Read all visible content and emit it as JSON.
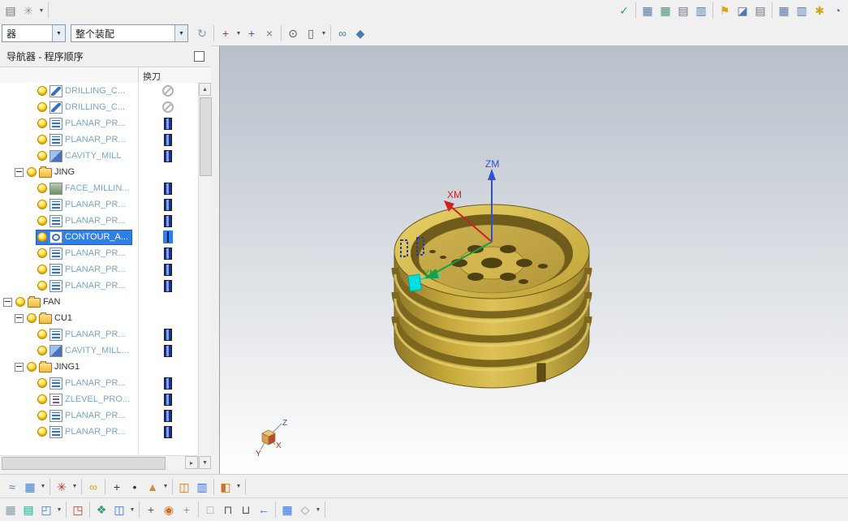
{
  "titlebar": {
    "left_icons": [
      {
        "name": "display-part-icon",
        "glyph": "▤",
        "color": "#4a7ab5"
      },
      {
        "name": "wcs-star-icon",
        "glyph": "✳",
        "color": "#8a97a5",
        "dropdown": true
      },
      {
        "sep": true
      }
    ],
    "right_icons": [
      {
        "name": "verify-check-icon",
        "glyph": "✓",
        "color": "#1faa3c"
      },
      {
        "sep": true
      },
      {
        "name": "worksheet-icon-1",
        "glyph": "▦",
        "color": "#4a7ab5"
      },
      {
        "name": "worksheet-icon-2",
        "glyph": "▦",
        "color": "#2e9e7a"
      },
      {
        "name": "worksheet-icon-3",
        "glyph": "▤",
        "color": "#4a7ab5"
      },
      {
        "name": "worksheet-icon-4",
        "glyph": "▥",
        "color": "#4a7ab5"
      },
      {
        "sep": true
      },
      {
        "name": "pin-icon",
        "glyph": "⚑",
        "color": "#e0a020"
      },
      {
        "name": "report-icon-1",
        "glyph": "◪",
        "color": "#4a7ab5"
      },
      {
        "name": "report-icon-2",
        "glyph": "▤",
        "color": "#4a7ab5"
      },
      {
        "sep": true
      },
      {
        "name": "report-icon-3",
        "glyph": "▦",
        "color": "#4a7ab5"
      },
      {
        "name": "report-icon-4",
        "glyph": "▥",
        "color": "#4a7ab5"
      },
      {
        "name": "tools-icon",
        "glyph": "✱",
        "color": "#d8a020"
      },
      {
        "name": "clock-icon",
        "glyph": "◔",
        "color": "#4a7ab5"
      }
    ]
  },
  "toolbar2": {
    "selection_filter_value": "器",
    "assembly_scope_value": "整个装配",
    "icons": [
      {
        "name": "refresh-icon",
        "glyph": "↻",
        "color": "#8a97a5"
      },
      {
        "sep": true
      },
      {
        "name": "snap-point-icon",
        "glyph": "+",
        "color": "#c03030",
        "dropdown": true
      },
      {
        "name": "snap-rotate-icon",
        "glyph": "+",
        "color": "#2b5fd9"
      },
      {
        "name": "snap-quick-icon",
        "glyph": "×",
        "color": "#7a7a7a"
      },
      {
        "sep": true
      },
      {
        "name": "circle-center-icon",
        "glyph": "⊙",
        "color": "#555555"
      },
      {
        "name": "rect-select-icon",
        "glyph": "▯",
        "color": "#555555",
        "dropdown": true
      },
      {
        "sep": true
      },
      {
        "name": "glasses-icon",
        "glyph": "∞",
        "color": "#4a7ab5"
      },
      {
        "name": "shaded-cube-icon",
        "glyph": "◆",
        "color": "#4a7ab5"
      }
    ]
  },
  "navigator": {
    "title": "导航器 - 程序顺序",
    "tool_change_column": "换刀",
    "rows": [
      {
        "label": "DRILLING_C...",
        "icon": "drill",
        "indent": 2,
        "tool": "none"
      },
      {
        "label": "DRILLING_C...",
        "icon": "drill",
        "indent": 2,
        "tool": "none"
      },
      {
        "label": "PLANAR_PR...",
        "icon": "planar",
        "indent": 2,
        "tool": "bar"
      },
      {
        "label": "PLANAR_PR...",
        "icon": "planar",
        "indent": 2,
        "tool": "bar"
      },
      {
        "label": "CAVITY_MILL",
        "icon": "cavity",
        "indent": 2,
        "tool": "bar"
      },
      {
        "label": "JING",
        "icon": "folder",
        "indent": 1,
        "toggle": true
      },
      {
        "label": "FACE_MILLIN...",
        "icon": "face",
        "indent": 2,
        "tool": "bar"
      },
      {
        "label": "PLANAR_PR...",
        "icon": "planar",
        "indent": 2,
        "tool": "bar"
      },
      {
        "label": "PLANAR_PR...",
        "icon": "planar",
        "indent": 2,
        "tool": "bar"
      },
      {
        "label": "CONTOUR_A...",
        "icon": "contour",
        "indent": 2,
        "tool": "bar",
        "selected": true
      },
      {
        "label": "PLANAR_PR...",
        "icon": "planar",
        "indent": 2,
        "tool": "bar"
      },
      {
        "label": "PLANAR_PR...",
        "icon": "planar",
        "indent": 2,
        "tool": "bar"
      },
      {
        "label": "PLANAR_PR...",
        "icon": "planar",
        "indent": 2,
        "tool": "bar"
      },
      {
        "label": "FAN",
        "icon": "folder",
        "indent": 0,
        "toggle": true
      },
      {
        "label": "CU1",
        "icon": "folder",
        "indent": 1,
        "toggle": true
      },
      {
        "label": "PLANAR_PR...",
        "icon": "planar",
        "indent": 2,
        "tool": "bar"
      },
      {
        "label": "CAVITY_MILL...",
        "icon": "cavity",
        "indent": 2,
        "tool": "bar"
      },
      {
        "label": "JING1",
        "icon": "folder",
        "indent": 1,
        "toggle": true
      },
      {
        "label": "PLANAR_PR...",
        "icon": "planar",
        "indent": 2,
        "tool": "bar"
      },
      {
        "label": "ZLEVEL_PRO...",
        "icon": "zlevel",
        "indent": 2,
        "tool": "bar"
      },
      {
        "label": "PLANAR_PR...",
        "icon": "planar",
        "indent": 2,
        "tool": "bar"
      },
      {
        "label": "PLANAR_PR...",
        "icon": "planar",
        "indent": 2,
        "tool": "bar"
      }
    ]
  },
  "viewport": {
    "axis_zm": "ZM",
    "axis_xm": "XM",
    "axis_ym": "YM",
    "triad_z": "Z",
    "triad_x": "X",
    "triad_y": "Y",
    "part_color": "#d0b347"
  },
  "toolbar_bottom1": {
    "icons": [
      {
        "name": "surface-wave-icon",
        "glyph": "≈",
        "color": "#4a7ab5"
      },
      {
        "name": "grid-ruler-icon",
        "glyph": "▦",
        "color": "#4a7ab5",
        "dropdown": true
      },
      {
        "sep": true
      },
      {
        "name": "color-star-icon",
        "glyph": "✳",
        "color": "#c03030",
        "dropdown": true
      },
      {
        "sep": true
      },
      {
        "name": "link-chain-icon",
        "glyph": "∞",
        "color": "#d8a020"
      },
      {
        "sep": true
      },
      {
        "name": "plus-icon",
        "glyph": "+",
        "color": "#333333"
      },
      {
        "name": "dot-icon",
        "glyph": "•",
        "color": "#333333"
      },
      {
        "name": "move-object-icon",
        "glyph": "▲",
        "color": "#c89050",
        "dropdown": true
      },
      {
        "sep": true
      },
      {
        "name": "measure-icon",
        "glyph": "◫",
        "color": "#d87020"
      },
      {
        "name": "library-icon",
        "glyph": "▥",
        "color": "#3a6fd8"
      },
      {
        "sep": true
      },
      {
        "name": "assembly-box-icon",
        "glyph": "◧",
        "color": "#d87020",
        "dropdown": true
      },
      {
        "sep": true
      }
    ]
  },
  "toolbar_bottom2": {
    "icons": [
      {
        "name": "window-grid-icon",
        "glyph": "▦",
        "color": "#8a97a5"
      },
      {
        "name": "sketch-sheet-icon",
        "glyph": "▤",
        "color": "#2e9e7a"
      },
      {
        "name": "new-component-icon",
        "glyph": "◰",
        "color": "#4a7ab5",
        "dropdown": true
      },
      {
        "sep": true
      },
      {
        "name": "cube-move-icon",
        "glyph": "◳",
        "color": "#b04030"
      },
      {
        "sep": true
      },
      {
        "name": "pattern-icon",
        "glyph": "❖",
        "color": "#2e9e7a"
      },
      {
        "name": "columns-icon",
        "glyph": "◫",
        "color": "#3a6fd8",
        "dropdown": true
      },
      {
        "sep": true
      },
      {
        "name": "add-grid-icon",
        "glyph": "+",
        "color": "#555555"
      },
      {
        "name": "sphere-grid-icon",
        "glyph": "◉",
        "color": "#d87020"
      },
      {
        "name": "plus-gray-icon",
        "glyph": "+",
        "color": "#8a97a5"
      },
      {
        "sep": true
      },
      {
        "name": "box-icon",
        "glyph": "□",
        "color": "#8a97a5"
      },
      {
        "name": "clamp-icon",
        "glyph": "⊓",
        "color": "#555555"
      },
      {
        "name": "fixture-icon",
        "glyph": "⊔",
        "color": "#555555"
      },
      {
        "name": "suppress-arrow-icon",
        "glyph": "←",
        "color": "#3a6fd8"
      },
      {
        "sep": true
      },
      {
        "name": "table-icon",
        "glyph": "▦",
        "color": "#3a6fd8"
      },
      {
        "name": "cube-axis-icon",
        "glyph": "◇",
        "color": "#8a97a5",
        "dropdown": true
      },
      {
        "sep": true
      }
    ]
  }
}
